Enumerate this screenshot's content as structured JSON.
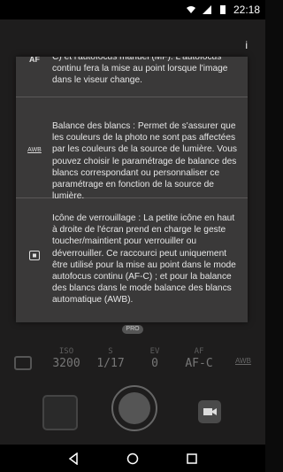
{
  "statusbar": {
    "time": "22:18"
  },
  "toolbar": {
    "info_label": "i"
  },
  "dialog": {
    "section1": {
      "icon_label": "AF",
      "text": "C) et l'autofocus manuel (MF). L'autofocus continu fera la mise au point lorsque l'image dans le viseur change."
    },
    "section2": {
      "icon_label": "AWB",
      "text": "Balance des blancs : Permet de s'assurer que les couleurs de la photo ne sont pas affectées par les couleurs de la source de lumière. Vous pouvez choisir le paramétrage de balance des blancs correspondant ou personnaliser ce paramétrage en fonction de la source de lumière."
    },
    "section3": {
      "text": "Icône de verrouillage : La petite icône en haut à droite de l'écran prend en charge le geste toucher/maintient pour verrouiller ou déverrouiller. Ce raccourci peut uniquement être utilisé pour la mise au point dans le mode autofocus continu (AF-C) ; et pour la balance des blancs dans le mode balance des blancs automatique (AWB)."
    }
  },
  "camera": {
    "mode_pill": "PRO",
    "params": [
      {
        "label": "ISO",
        "value": "3200"
      },
      {
        "label": "S",
        "value": "1/17"
      },
      {
        "label": "EV",
        "value": "0"
      },
      {
        "label": "AF",
        "value": "AF-C"
      }
    ],
    "awb_label": "AWB"
  }
}
